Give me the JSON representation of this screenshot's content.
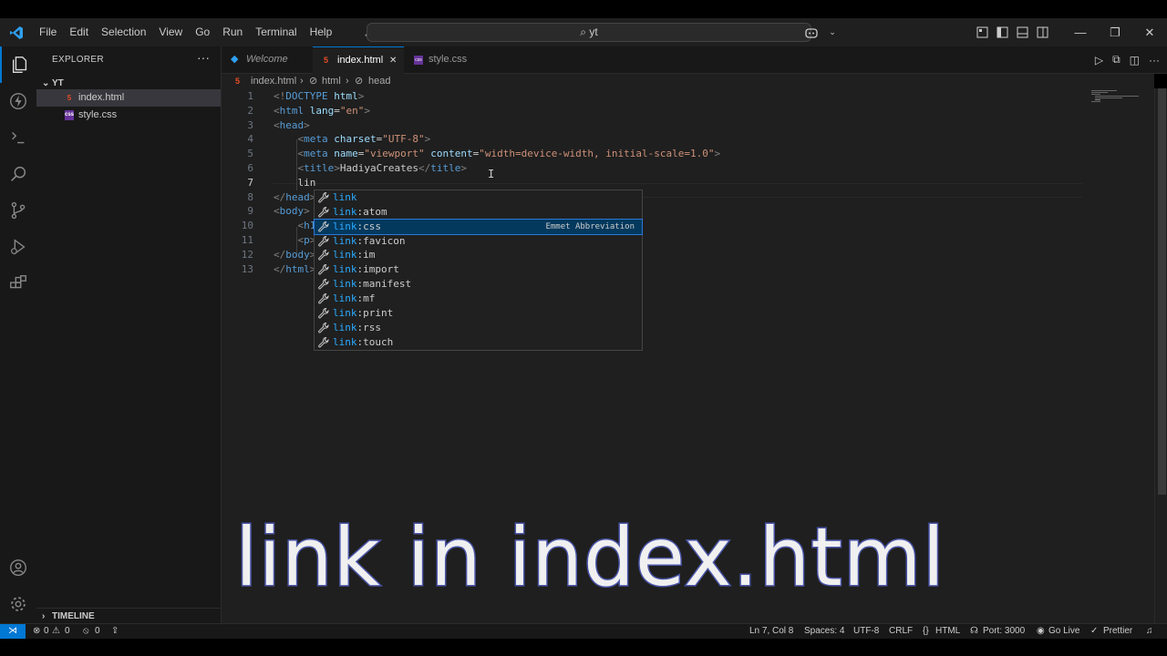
{
  "menu": [
    "File",
    "Edit",
    "Selection",
    "View",
    "Go",
    "Run",
    "Terminal",
    "Help"
  ],
  "search": {
    "text": "yt"
  },
  "explorer": {
    "title": "EXPLORER",
    "folder": "YT",
    "files": [
      {
        "name": "index.html",
        "badge": "5",
        "color": "#e44d26"
      },
      {
        "name": "style.css",
        "badge": "css",
        "color": "#a074c4"
      }
    ],
    "timeline": "TIMELINE"
  },
  "tabs": [
    {
      "label": "Welcome"
    },
    {
      "label": "index.html",
      "close": "✕"
    },
    {
      "label": "style.css"
    }
  ],
  "breadcrumb": {
    "file": "index.html",
    "sep1": "›",
    "html": "html",
    "sep2": "›",
    "head": "head"
  },
  "code_lines": [
    {
      "n": "1",
      "html": "<span class='t'>&lt;!</span><span class='tag'>DOCTYPE</span> <span class='attr'>html</span><span class='t'>&gt;</span>"
    },
    {
      "n": "2",
      "html": "<span class='t'>&lt;</span><span class='tag'>html</span> <span class='attr'>lang</span><span class='txt'>=</span><span class='str'>\"en\"</span><span class='t'>&gt;</span>"
    },
    {
      "n": "3",
      "html": "<span class='t'>&lt;</span><span class='tag'>head</span><span class='t'>&gt;</span>"
    },
    {
      "n": "4",
      "html": "    <span class='t'>&lt;</span><span class='tag'>meta</span> <span class='attr'>charset</span><span class='txt'>=</span><span class='str'>\"UTF-8\"</span><span class='t'>&gt;</span>"
    },
    {
      "n": "5",
      "html": "    <span class='t'>&lt;</span><span class='tag'>meta</span> <span class='attr'>name</span><span class='txt'>=</span><span class='str'>\"viewport\"</span> <span class='attr'>content</span><span class='txt'>=</span><span class='str'>\"width=device-width, initial-scale=1.0\"</span><span class='t'>&gt;</span>"
    },
    {
      "n": "6",
      "html": "    <span class='t'>&lt;</span><span class='tag'>title</span><span class='t'>&gt;</span><span class='txt'>HadiyaCreates</span><span class='t'>&lt;/</span><span class='tag'>title</span><span class='t'>&gt;</span>"
    },
    {
      "n": "7",
      "html": "    <span class='txt'>lin</span>"
    },
    {
      "n": "8",
      "html": "<span class='t'>&lt;/</span><span class='tag'>head</span><span class='t'>&gt;</span>"
    },
    {
      "n": "9",
      "html": "<span class='t'>&lt;</span><span class='tag'>body</span><span class='t'>&gt;</span>"
    },
    {
      "n": "10",
      "html": "    <span class='t'>&lt;</span><span class='tag'>h1</span>"
    },
    {
      "n": "11",
      "html": "    <span class='t'>&lt;</span><span class='tag'>p</span><span class='t'>&gt;</span>"
    },
    {
      "n": "12",
      "html": "<span class='t'>&lt;/</span><span class='tag'>body</span><span class='t'>&gt;</span>"
    },
    {
      "n": "13",
      "html": "<span class='t'>&lt;/</span><span class='tag'>html</span><span class='t'>&gt;</span>"
    }
  ],
  "suggestions": [
    {
      "match": "link",
      "rest": ""
    },
    {
      "match": "link",
      "rest": ":atom"
    },
    {
      "match": "link",
      "rest": ":css",
      "detail": "Emmet Abbreviation",
      "selected": true
    },
    {
      "match": "link",
      "rest": ":favicon"
    },
    {
      "match": "link",
      "rest": ":im"
    },
    {
      "match": "link",
      "rest": ":import"
    },
    {
      "match": "link",
      "rest": ":manifest"
    },
    {
      "match": "link",
      "rest": ":mf"
    },
    {
      "match": "link",
      "rest": ":print"
    },
    {
      "match": "link",
      "rest": ":rss"
    },
    {
      "match": "link",
      "rest": ":touch"
    }
  ],
  "caption": "link in index.html",
  "status": {
    "errors": "0",
    "warnings": "0",
    "ports": "0",
    "position": "Ln 7, Col 8",
    "spaces": "Spaces: 4",
    "encoding": "UTF-8",
    "eol": "CRLF",
    "language": "HTML",
    "port": "Port: 3000",
    "golive": "Go Live",
    "prettier": "Prettier"
  },
  "colors": {
    "accent": "#0078d4",
    "editor_bg": "#1f1f1f",
    "caption_stroke": "#4a55a8"
  }
}
